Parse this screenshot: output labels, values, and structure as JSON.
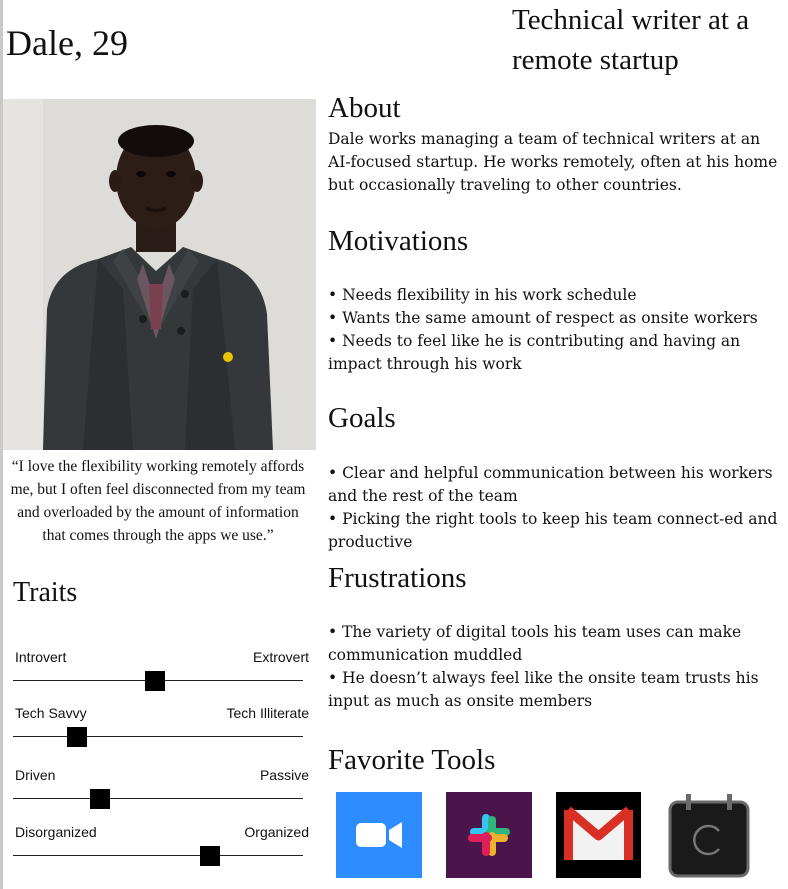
{
  "persona": {
    "name": "Dale, 29",
    "role": "Technical writer at a remote startup"
  },
  "about": {
    "title": "About",
    "text": "Dale works managing a team of technical writers at an AI-focused startup. He works remotely, often at his home but occasionally traveling to other countries."
  },
  "motivations": {
    "title": "Motivations",
    "items": [
      "• Needs flexibility in his work schedule",
      "• Wants the same amount of respect as onsite workers",
      "• Needs to feel like he is contributing and having an impact through his work"
    ]
  },
  "goals": {
    "title": "Goals",
    "items": [
      "• Clear and helpful communication between his workers and the rest of the team",
      "• Picking the right tools to keep his team connect-ed and productive"
    ]
  },
  "frustrations": {
    "title": "Frustrations",
    "items": [
      "• The variety of digital tools his team uses can make communication muddled",
      "• He doesn’t always feel like the onsite team trusts his input as much as onsite members"
    ]
  },
  "quote": "“I love the flexibility working remotely affords me, but I often feel disconnected from my team and overloaded by the amount of information that comes through the apps we use.”",
  "traits": {
    "title": "Traits",
    "items": [
      {
        "left": "Introvert",
        "right": "Extrovert",
        "level": 0.49
      },
      {
        "left": "Tech Savvy",
        "right": "Tech Illiterate",
        "level": 0.22
      },
      {
        "left": "Driven",
        "right": "Passive",
        "level": 0.3
      },
      {
        "left": "Disorganized",
        "right": "Organized",
        "level": 0.68
      }
    ]
  },
  "tools": {
    "title": "Favorite Tools",
    "items": [
      {
        "icon": "zoom-icon",
        "color": "#2d8cff"
      },
      {
        "icon": "slack-icon",
        "color": "#4a154b"
      },
      {
        "icon": "gmail-icon",
        "color": "#000000"
      },
      {
        "icon": "calendar-icon",
        "color": "#1a1a1a"
      }
    ]
  }
}
